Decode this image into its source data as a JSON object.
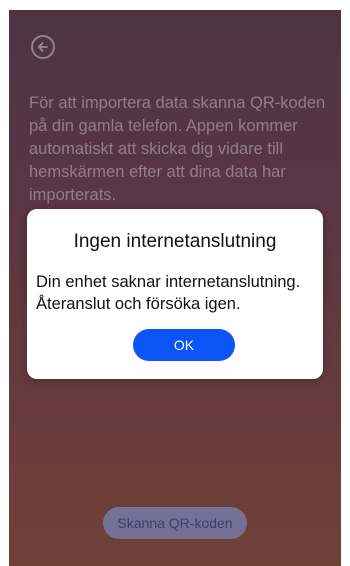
{
  "background": {
    "instructions": "För att importera data skanna QR-koden på din gamla telefon. Appen kommer automatiskt att skicka dig vidare till hemskärmen efter att dina data har importerats."
  },
  "dialog": {
    "title": "Ingen internetanslutning",
    "message": "Din enhet saknar internetanslutning. Återanslut och försöka igen.",
    "ok_label": "OK"
  },
  "footer": {
    "scan_label": "Skanna QR-koden"
  },
  "colors": {
    "primary_button": "#0b54f5",
    "secondary_button": "#7882b4"
  }
}
